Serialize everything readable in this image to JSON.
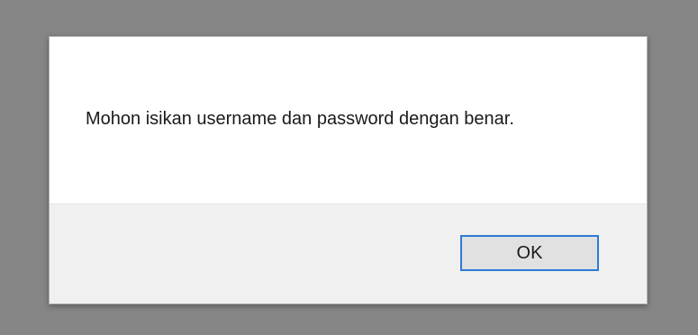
{
  "dialog": {
    "message": "Mohon isikan username dan password dengan benar.",
    "ok_label": "OK"
  },
  "colors": {
    "backdrop": "#868686",
    "dialog_background": "#ffffff",
    "footer_background": "#f0f0f0",
    "button_background": "#e1e1e1",
    "button_focus_border": "#2e7bd6"
  }
}
